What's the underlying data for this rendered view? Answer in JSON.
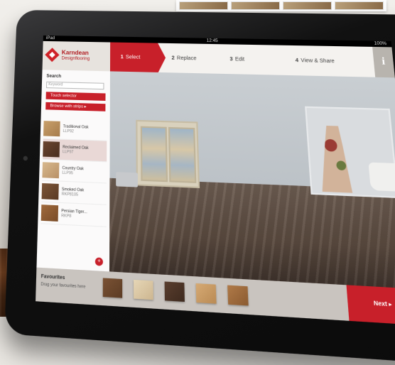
{
  "status": {
    "carrier": "iPad",
    "time": "12:45",
    "battery": "100%"
  },
  "brand": {
    "name": "Karndean",
    "subtitle": "Designflooring",
    "color": "#c8202a"
  },
  "steps": [
    {
      "num": "1",
      "label": "Select",
      "active": true
    },
    {
      "num": "2",
      "label": "Replace"
    },
    {
      "num": "3",
      "label": "Edit"
    },
    {
      "num": "4",
      "label": "View & Share"
    }
  ],
  "info_icon": "i",
  "sidebar": {
    "search_label": "Search",
    "search_placeholder": "Keyword",
    "touch_selector_label": "Touch selector",
    "browse_label": "Browse with strips ▸",
    "items": [
      {
        "name": "Traditional Oak",
        "code": "LLP92",
        "color": "#b9915e"
      },
      {
        "name": "Reclaimed Oak",
        "code": "LLP97",
        "color": "#5a3a26",
        "selected": true
      },
      {
        "name": "Country Oak",
        "code": "LLP95",
        "color": "#c9a47a"
      },
      {
        "name": "Smoked Oak",
        "code": "RKP8105",
        "color": "#6d4a30"
      },
      {
        "name": "Persian Tiger...",
        "code": "RKP8",
        "color": "#8a5a34"
      }
    ],
    "add_icon": "+"
  },
  "bottom": {
    "favourites_label": "Favourites",
    "favourites_sub": "Drag your favourites here",
    "favourites": [
      "#6e4a2c",
      "#d9c7a4",
      "#4d3426",
      "#c79a66",
      "#a06a3c"
    ],
    "next_label": "Next ▸"
  }
}
